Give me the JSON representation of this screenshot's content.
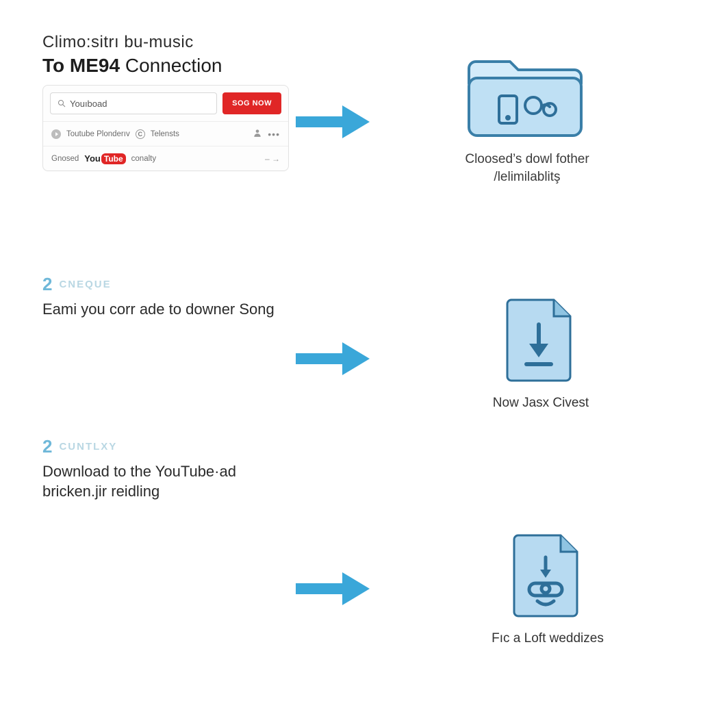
{
  "header": {
    "line1": "Climo:sitrı bu-music",
    "strong": "To ME94",
    "rest": " Connection"
  },
  "search_card": {
    "placeholder": "Youıboad",
    "button": "SOG NOW",
    "row2_a": "Toutube Plonderıv",
    "row2_b": "Telensts",
    "row3_a": "Gnosed",
    "row3_logo_a": "You",
    "row3_logo_b": "Tube",
    "row3_c": "conalty"
  },
  "steps": {
    "s2": {
      "num": "2",
      "word": "CNEQUE",
      "desc": "Eami you corr ade to downer Song"
    },
    "s3": {
      "num": "2",
      "word": "CUNTLXY",
      "desc": "Download to the YouTube·ad bricken.jir reidling"
    }
  },
  "right": {
    "folder_cap": "Cloosed’s dowl fother /lelimilablitş",
    "file1_cap": "Now Jasx Civest",
    "file2_cap": "Fıc a Loft weddizes"
  },
  "colors": {
    "arrow": "#3aa7d9",
    "folder_fill": "#bfe0f4",
    "folder_stroke": "#3a7fa8",
    "file_fill": "#b7daf1",
    "file_stroke": "#2e6f99"
  }
}
